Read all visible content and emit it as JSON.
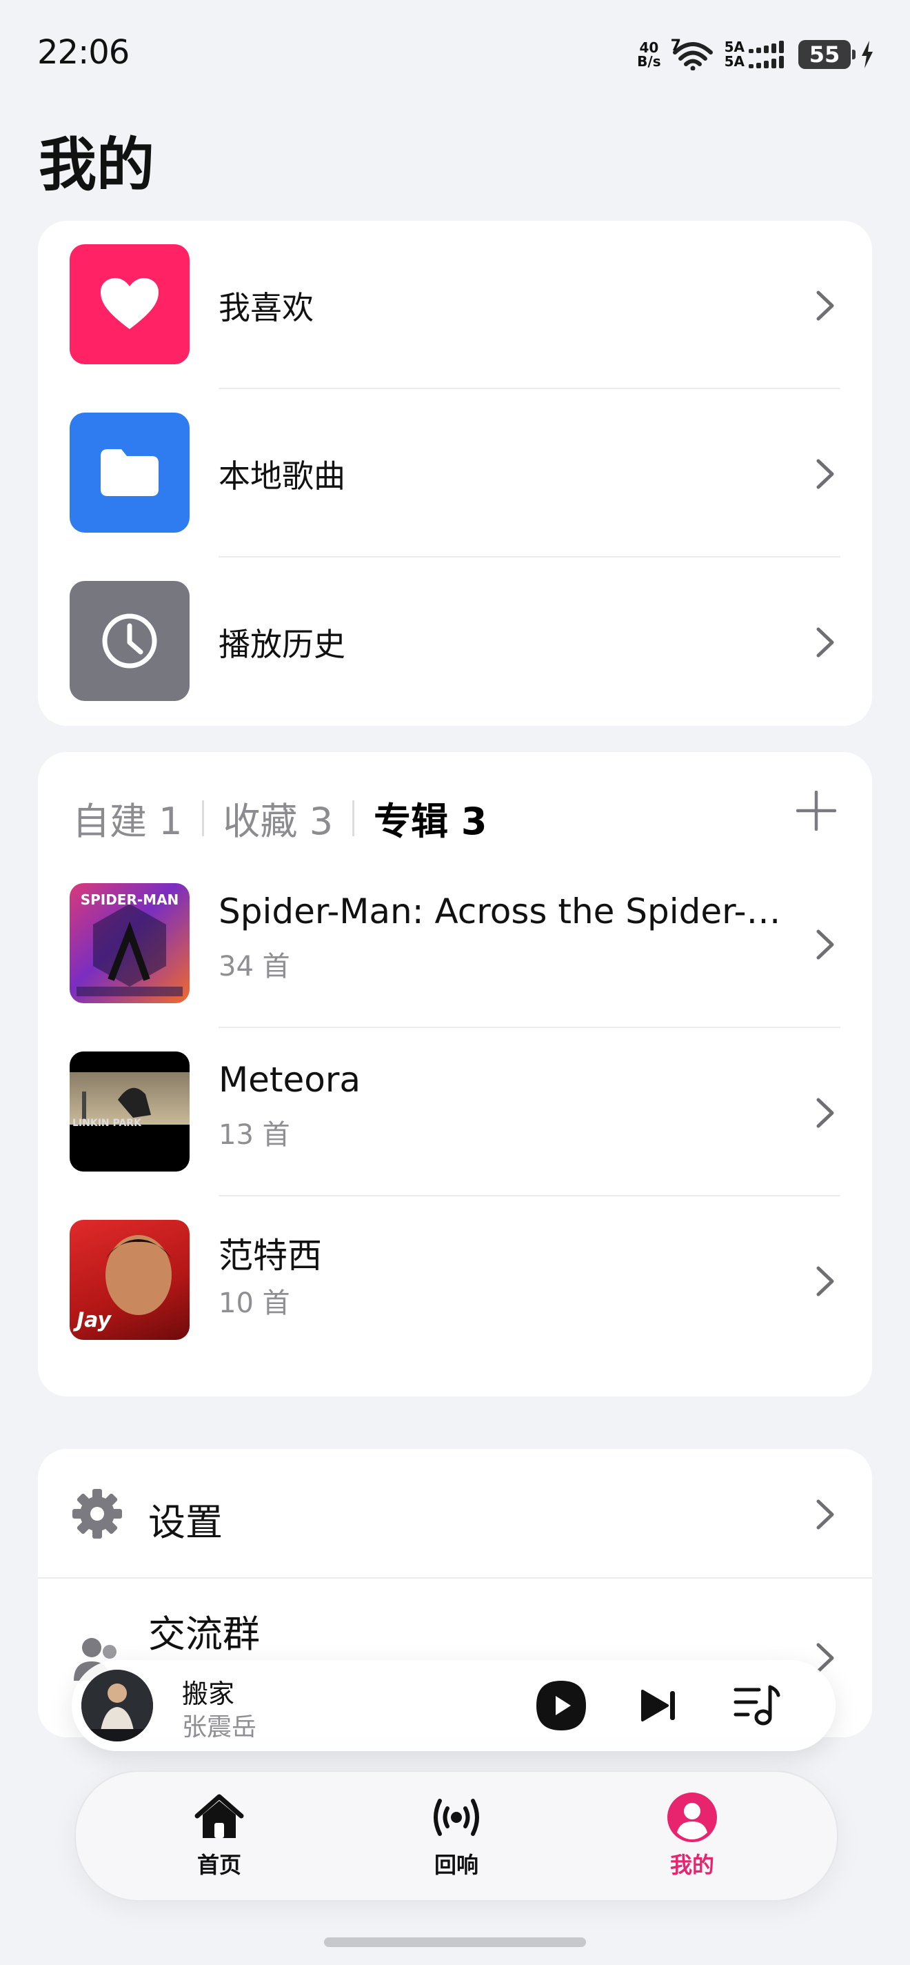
{
  "status": {
    "time": "22:06",
    "speed_value": "40",
    "speed_unit": "B/s",
    "wifi_badge": "7",
    "sim1": "5A",
    "sim2": "5A",
    "battery": "55"
  },
  "page_title": "我的",
  "quick_links": [
    {
      "label": "我喜欢",
      "icon": "heart-icon",
      "color": "#ff2366"
    },
    {
      "label": "本地歌曲",
      "icon": "folder-icon",
      "color": "#2f7cf0"
    },
    {
      "label": "播放历史",
      "icon": "clock-icon",
      "color": "#77777f"
    }
  ],
  "playlist_tabs": [
    {
      "label": "自建 1",
      "active": false
    },
    {
      "label": "收藏 3",
      "active": false
    },
    {
      "label": "专辑 3",
      "active": true
    }
  ],
  "albums": [
    {
      "title": "Spider-Man: Across the Spider-…",
      "count": "34 首",
      "art_text": "SPIDER-MAN"
    },
    {
      "title": "Meteora",
      "count": "13 首",
      "art_text": "LINKIN PARK"
    },
    {
      "title": "范特西",
      "count": "10 首",
      "art_text": "Jay"
    }
  ],
  "settings": [
    {
      "label": "设置",
      "icon": "gear-icon"
    },
    {
      "label": "交流群",
      "icon": "group-icon"
    }
  ],
  "player": {
    "title": "搬家",
    "artist": "张震岳"
  },
  "nav": [
    {
      "label": "首页",
      "icon": "home-icon"
    },
    {
      "label": "回响",
      "icon": "broadcast-icon"
    },
    {
      "label": "我的",
      "icon": "profile-icon",
      "active_color": "#e8246f"
    }
  ]
}
